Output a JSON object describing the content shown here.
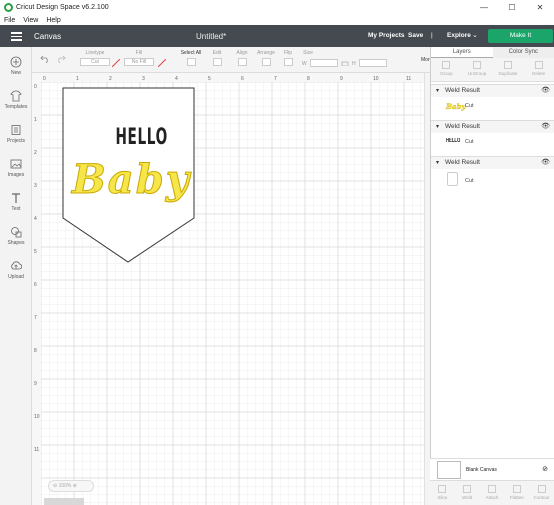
{
  "window": {
    "title": "Cricut Design Space  v6.2.100",
    "controls": [
      "—",
      "☐",
      "✕"
    ]
  },
  "menu": [
    "File",
    "View",
    "Help"
  ],
  "header": {
    "section": "Canvas",
    "doc_title": "Untitled*",
    "my_projects": "My Projects",
    "save": "Save",
    "separator": "|",
    "explore": "Explore",
    "make_it": "Make It"
  },
  "left_nav": [
    {
      "label": "New",
      "icon": "plus-icon"
    },
    {
      "label": "Templates",
      "icon": "shirt-icon"
    },
    {
      "label": "Projects",
      "icon": "projects-icon"
    },
    {
      "label": "Images",
      "icon": "image-icon"
    },
    {
      "label": "Text",
      "icon": "text-icon"
    },
    {
      "label": "Shapes",
      "icon": "shapes-icon"
    },
    {
      "label": "Upload",
      "icon": "upload-icon"
    }
  ],
  "toolbar": {
    "linetype": "Linetype",
    "linetype_val": "Cut",
    "fill": "Fill",
    "fill_val": "No Fill",
    "select_all": "Select All",
    "edit": "Edit",
    "align": "Align",
    "arrange": "Arrange",
    "flip": "Flip",
    "size": "Size",
    "w": "W",
    "h": "H",
    "more": "More▾"
  },
  "ruler": {
    "top": [
      "0",
      "1",
      "2",
      "3",
      "4",
      "5",
      "6",
      "7",
      "8",
      "9",
      "10",
      "11",
      "12"
    ],
    "left": [
      "0",
      "1",
      "2",
      "3",
      "4",
      "5",
      "6",
      "7",
      "8",
      "9",
      "10",
      "11"
    ]
  },
  "zoom": "100%",
  "right_panel": {
    "tabs": [
      "Layers",
      "Color Sync"
    ],
    "tools": [
      "Group",
      "UnGroup",
      "Duplicate",
      "Delete"
    ],
    "groups": [
      {
        "title": "Weld Result",
        "layer": "Cut",
        "thumb": "Baby"
      },
      {
        "title": "Weld Result",
        "layer": "Cut",
        "thumb": "HELLO"
      },
      {
        "title": "Weld Result",
        "layer": "Cut",
        "thumb": ""
      }
    ],
    "blank_canvas": "Blank Canvas",
    "bottom_tools": [
      "Slice",
      "Weld",
      "Attach",
      "Flatten",
      "Contour"
    ]
  },
  "design": {
    "line1": "HELLO",
    "line2": "Baby",
    "baby_fill": "#f7e64a",
    "baby_stroke": "#c9a800"
  },
  "colors": {
    "header_bg": "#444a50",
    "make_it": "#1ba56a"
  }
}
